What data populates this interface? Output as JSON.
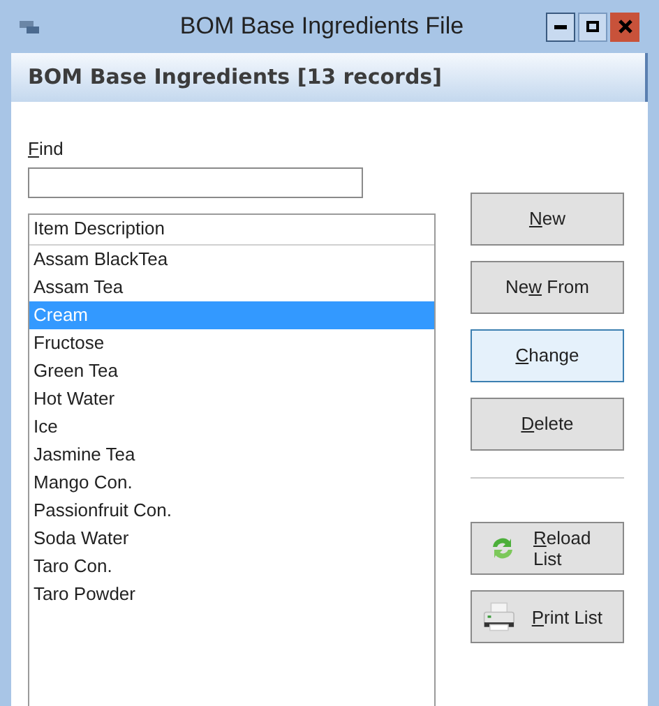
{
  "window": {
    "title": "BOM Base Ingredients File"
  },
  "header": {
    "title": "BOM Base Ingredients [13 records]"
  },
  "find": {
    "access_key": "F",
    "label_after": "ind"
  },
  "list": {
    "column": "Item Description",
    "items": [
      {
        "text": "Assam BlackTea",
        "selected": false
      },
      {
        "text": "Assam Tea",
        "selected": false
      },
      {
        "text": "Cream",
        "selected": true
      },
      {
        "text": "Fructose",
        "selected": false
      },
      {
        "text": "Green Tea",
        "selected": false
      },
      {
        "text": "Hot Water",
        "selected": false
      },
      {
        "text": "Ice",
        "selected": false
      },
      {
        "text": "Jasmine Tea",
        "selected": false
      },
      {
        "text": "Mango Con.",
        "selected": false
      },
      {
        "text": "Passionfruit Con.",
        "selected": false
      },
      {
        "text": "Soda Water",
        "selected": false
      },
      {
        "text": "Taro Con.",
        "selected": false
      },
      {
        "text": "Taro Powder",
        "selected": false
      }
    ]
  },
  "buttons": [
    {
      "kind": "text",
      "access_key": "N",
      "label_after": "ew",
      "focused": false
    },
    {
      "kind": "text",
      "label_before": "Ne",
      "access_key": "w",
      "label_after": " From",
      "focused": false
    },
    {
      "kind": "text",
      "access_key": "C",
      "label_after": "hange",
      "focused": true
    },
    {
      "kind": "text",
      "access_key": "D",
      "label_after": "elete",
      "focused": false
    },
    {
      "kind": "separator"
    },
    {
      "kind": "reload",
      "access_key": "R",
      "label_after": "eload List",
      "focused": false
    },
    {
      "kind": "print",
      "access_key": "P",
      "label_after": "rint List",
      "focused": false
    }
  ]
}
